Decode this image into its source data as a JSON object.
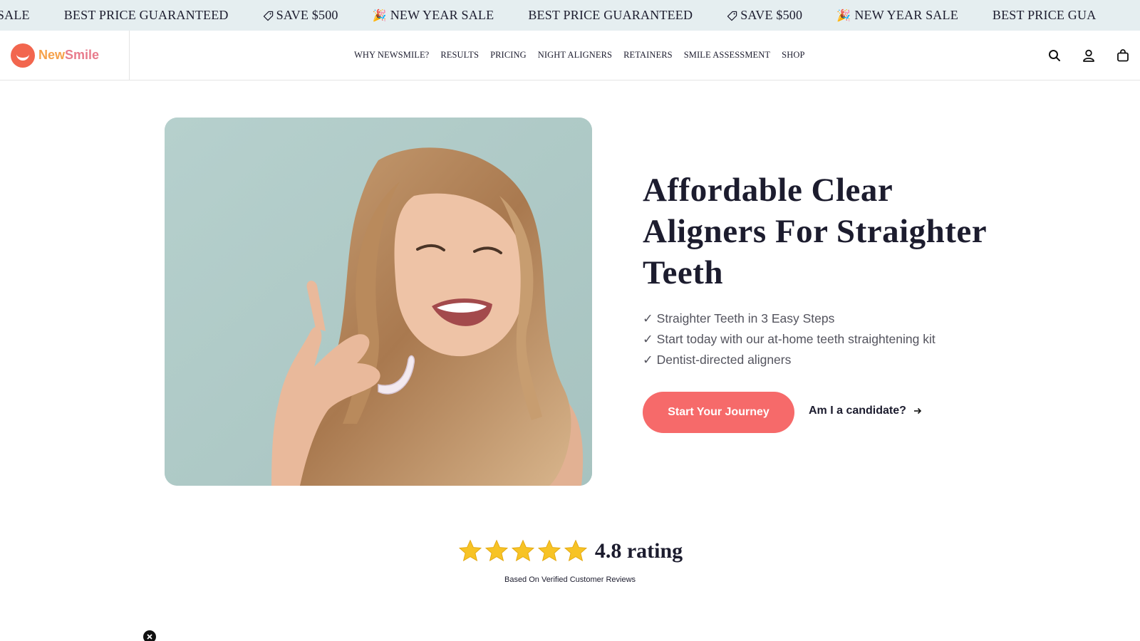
{
  "announcement": {
    "items": [
      {
        "icon": "",
        "emoji": "",
        "text": "R SALE"
      },
      {
        "icon": "",
        "emoji": "",
        "text": "BEST PRICE GUARANTEED"
      },
      {
        "icon": "tag-icon",
        "emoji": "",
        "text": "SAVE $500"
      },
      {
        "icon": "party-popper-icon",
        "emoji": "🎉",
        "text": "NEW YEAR SALE"
      },
      {
        "icon": "",
        "emoji": "",
        "text": "BEST PRICE GUARANTEED"
      },
      {
        "icon": "tag-icon",
        "emoji": "",
        "text": "SAVE $500"
      },
      {
        "icon": "party-popper-icon",
        "emoji": "🎉",
        "text": "NEW YEAR SALE"
      },
      {
        "icon": "",
        "emoji": "",
        "text": "BEST PRICE GUA"
      }
    ]
  },
  "header": {
    "logo": {
      "part1": "New",
      "part2": "Smile",
      "mark_color": "#f2664e"
    },
    "nav": [
      "WHY NEWSMILE?",
      "RESULTS",
      "PRICING",
      "NIGHT ALIGNERS",
      "RETAINERS",
      "SMILE ASSESSMENT",
      "SHOP"
    ],
    "icons": [
      "search-icon",
      "account-icon",
      "cart-icon"
    ]
  },
  "hero": {
    "image": {
      "icon": "hero-photo",
      "background": "#b1cbc8"
    },
    "title": "Affordable Clear Aligners For Straighter Teeth",
    "bullets": [
      "Straighter Teeth in 3 Easy Steps",
      "Start today with our at-home teeth straightening kit",
      "Dentist-directed aligners"
    ],
    "bullet_mark": "✓",
    "cta_label": "Start Your Journey",
    "cta_color": "#f66a6a",
    "candidate_label": "Am I a candidate?"
  },
  "rating": {
    "stars": 5,
    "value_text": "4.8 rating",
    "subtext": "Based On Verified Customer Reviews",
    "star_color": "#f7c325"
  },
  "widget": {
    "icon": "close-icon"
  }
}
